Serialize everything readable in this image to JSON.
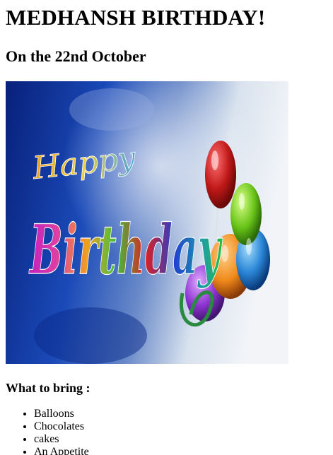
{
  "page": {
    "title": "MEDHANSH BIRTHDAY!",
    "date_heading": "On the 22nd October"
  },
  "banner": {
    "happy": "Happy",
    "birthday": "Birthday",
    "colors": {
      "background_dark": "#0a2a8a",
      "background_light": "#e6ecf2",
      "balloon_red": "#c01818",
      "balloon_green": "#6ac418",
      "balloon_orange": "#f08a1a",
      "balloon_blue": "#2a86d6",
      "balloon_purple": "#8a2ad0"
    }
  },
  "bring": {
    "heading": "What to bring :",
    "items": [
      "Balloons",
      "Chocolates",
      "cakes",
      "An Appetite"
    ]
  }
}
